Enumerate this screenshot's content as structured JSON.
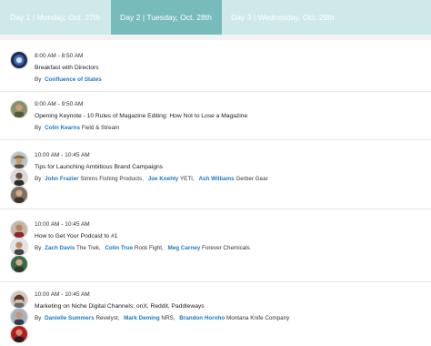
{
  "tabs": [
    {
      "label": "Day 1 | Monday, Oct. 27th",
      "active": false
    },
    {
      "label": "Day 2 | Tuesday, Oct. 28th",
      "active": true
    },
    {
      "label": "Day 3 | Wednesday, Oct. 29th",
      "active": false
    }
  ],
  "colors": {
    "tab_bar": "#cfe9ea",
    "tab_active": "#78bbbb",
    "link": "#1e78c6"
  },
  "by_label": "By",
  "sessions": [
    {
      "time": "8:00 AM - 8:50 AM",
      "title": "Breakfast with Directors",
      "speakers": [
        {
          "name": "Confluence of States",
          "company": ""
        }
      ]
    },
    {
      "time": "9:00 AM - 9:50 AM",
      "title": "Opening Keynote - 10 Rules of Magazine Editing: How Not to Lose a Magazine",
      "speakers": [
        {
          "name": "Colin Kearns",
          "company": "Field & Stream"
        }
      ]
    },
    {
      "time": "10:00 AM - 10:45 AM",
      "title": "Tips for Launching Ambitious Brand Campaigns",
      "speakers": [
        {
          "name": "John Frazier",
          "company": "Simms Fishing Products,"
        },
        {
          "name": "Joe Koehly",
          "company": "YETI,"
        },
        {
          "name": "Ash Williams",
          "company": "Gerber Gear"
        }
      ]
    },
    {
      "time": "10:00 AM - 10:45 AM",
      "title": "How to Get Your Podcast to #1",
      "speakers": [
        {
          "name": "Zach Davis",
          "company": "The Trek,"
        },
        {
          "name": "Colin True",
          "company": "Rock Fight,"
        },
        {
          "name": "Meg Carney",
          "company": "Forever Chemicals"
        }
      ]
    },
    {
      "time": "10:00 AM - 10:45 AM",
      "title": "Marketing on Niche Digital Channels: onX, Reddit, Paddleways",
      "speakers": [
        {
          "name": "Danielle Summers",
          "company": "Revelyst,"
        },
        {
          "name": "Mark Deming",
          "company": "NRS,"
        },
        {
          "name": "Brandon Horoho",
          "company": "Montana Knife Company"
        }
      ]
    }
  ]
}
